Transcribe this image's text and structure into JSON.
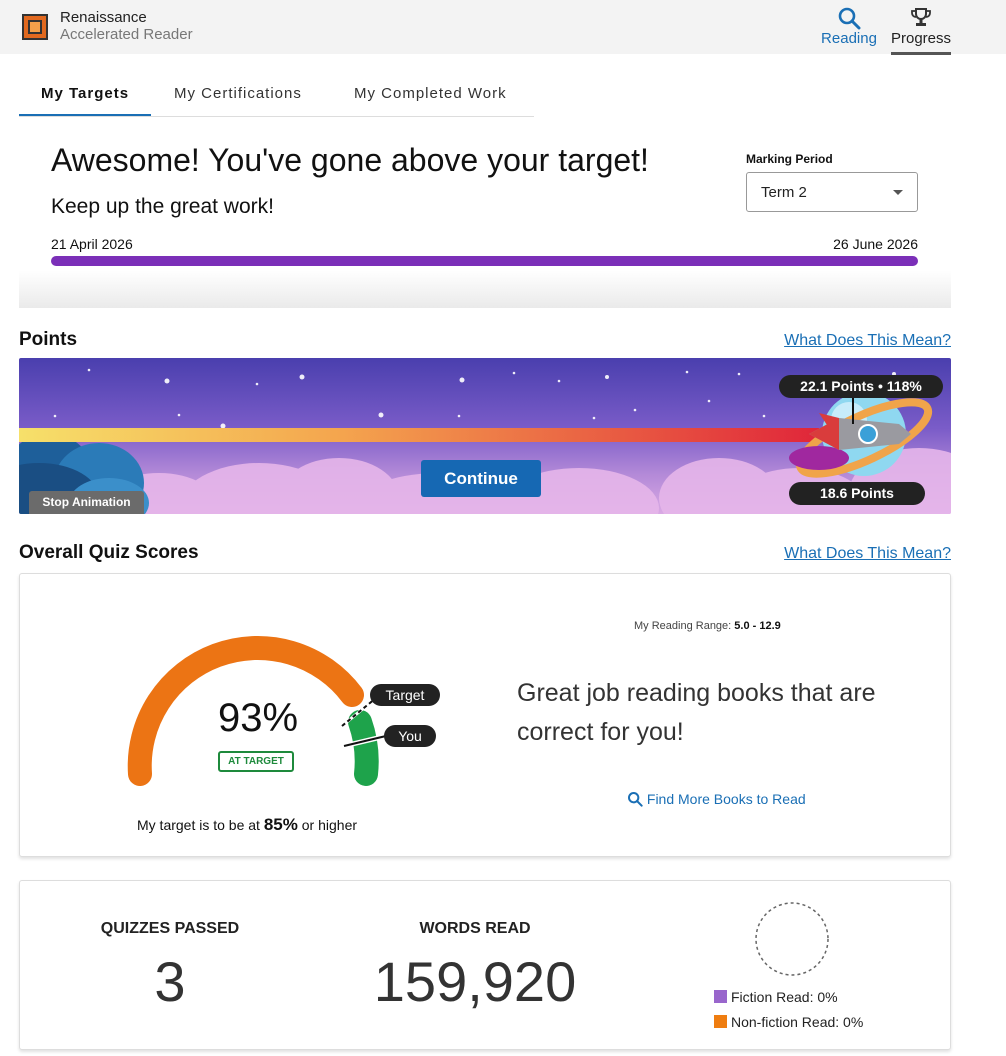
{
  "header": {
    "brand_line1": "Renaissance",
    "brand_line2": "Accelerated Reader",
    "nav": [
      {
        "label": "Reading",
        "icon": "search-icon"
      },
      {
        "label": "Progress",
        "icon": "trophy-icon"
      }
    ]
  },
  "tabs": [
    {
      "label": "My Targets",
      "active": true
    },
    {
      "label": "My Certifications",
      "active": false
    },
    {
      "label": "My Completed Work",
      "active": false
    }
  ],
  "target": {
    "headline": "Awesome! You've gone above your target!",
    "subline": "Keep up the great work!",
    "marking_period_label": "Marking Period",
    "marking_period_value": "Term 2",
    "start_date": "21 April 2026",
    "end_date": "26 June 2026",
    "bar_color": "#7b2fb8"
  },
  "points": {
    "title": "Points",
    "help_link": "What Does This Mean?",
    "earned_label": "22.1 Points • 118%",
    "target_label": "18.6 Points",
    "continue_label": "Continue",
    "stop_animation_label": "Stop Animation"
  },
  "quiz": {
    "title": "Overall Quiz Scores",
    "help_link": "What Does This Mean?",
    "percent": "93%",
    "percent_value": 93,
    "status_badge": "AT TARGET",
    "target_prefix": "My target is to be at ",
    "target_value": "85%",
    "target_suffix": " or higher",
    "target_tag": "Target",
    "you_tag": "You",
    "reading_range_label": "My Reading Range:",
    "reading_range_value": "5.0 - 12.9",
    "message": "Great job reading books that are correct for you!",
    "find_more_label": "Find More Books to Read"
  },
  "stats": {
    "quizzes_passed_label": "QUIZZES PASSED",
    "quizzes_passed_value": "3",
    "words_read_label": "WORDS READ",
    "words_read_value": "159,920",
    "fiction_label": "Fiction Read: 0%",
    "nonfiction_label": "Non-fiction Read: 0%",
    "fiction_color": "#9966cc",
    "nonfiction_color": "#ef7d10"
  },
  "colors": {
    "accent": "#1a6fb5",
    "gauge_orange": "#ec7414",
    "gauge_green": "#1ea34b"
  }
}
